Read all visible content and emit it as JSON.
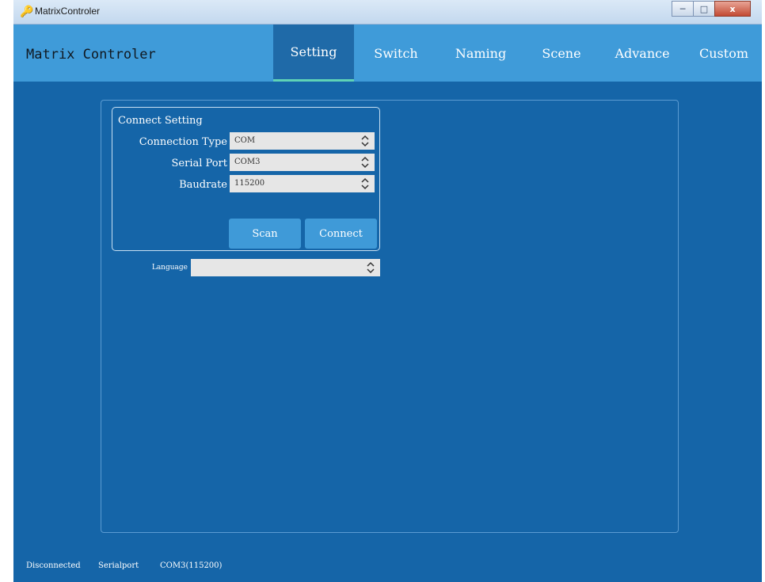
{
  "window": {
    "title": "MatrixControler",
    "controls": {
      "minimize": "─",
      "maximize": "□",
      "close": "x"
    }
  },
  "header": {
    "app_title": "Matrix Controler",
    "tabs": [
      {
        "label": "Setting",
        "active": true
      },
      {
        "label": "Switch",
        "active": false
      },
      {
        "label": "Naming",
        "active": false
      },
      {
        "label": "Scene",
        "active": false
      },
      {
        "label": "Advance",
        "active": false
      },
      {
        "label": "Custom",
        "active": false
      }
    ]
  },
  "connect": {
    "group_title": "Connect Setting",
    "connection_type": {
      "label": "Connection Type",
      "value": "COM"
    },
    "serial_port": {
      "label": "Serial Port",
      "value": "COM3"
    },
    "baudrate": {
      "label": "Baudrate",
      "value": "115200"
    },
    "scan_label": "Scan",
    "connect_label": "Connect"
  },
  "language": {
    "label": "Language",
    "value": ""
  },
  "status": {
    "connection": "Disconnected",
    "interface": "Serialport",
    "port_info": "COM3(115200)"
  },
  "colors": {
    "background": "#1565a8",
    "header": "#3f9bd9",
    "active_tab": "#1f6aa8",
    "active_indicator": "#5fd3b6",
    "button": "#3f9ad8"
  }
}
